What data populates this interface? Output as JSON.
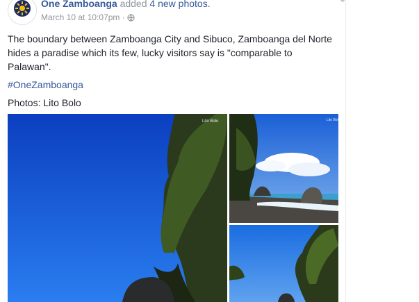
{
  "post": {
    "page_name": "One Zamboanga",
    "action_prefix": "added",
    "action_link": "4 new photos.",
    "timestamp": "March 10 at 10:07pm",
    "separator": "·",
    "privacy_icon": "globe-icon",
    "body": "The boundary between Zamboanga City and Sibuco, Zamboanga del Norte hides a paradise which its few, lucky visitors say is \"comparable to Palawan\".",
    "hashtag": "#OneZamboanga",
    "credit": "Photos: Lito Bolo",
    "avatar_icon": "sun-logo-icon",
    "options_icon": "chevron-down-icon"
  },
  "photos": [
    {
      "name": "photo-rock-tree-sky"
    },
    {
      "name": "photo-beach-cliff"
    },
    {
      "name": "photo-cliff-tree"
    }
  ],
  "colors": {
    "link": "#365899",
    "meta": "#90949c",
    "text": "#1d2129",
    "sky": "#1a5fd6"
  }
}
